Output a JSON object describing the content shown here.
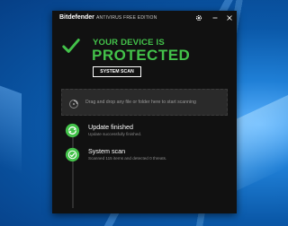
{
  "window": {
    "brand": "Bitdefender",
    "edition": "ANTIVIRUS FREE EDITION"
  },
  "titlebar_icons": [
    "gear-icon",
    "minimize-icon",
    "close-icon"
  ],
  "hero": {
    "line1": "YOUR DEVICE IS",
    "line2": "PROTECTED",
    "scan_button": "SYSTEM SCAN"
  },
  "dropzone": {
    "text": "Drag and drop any file or folder here to start scanning"
  },
  "events": [
    {
      "title": "Update finished",
      "desc": "Update successfully finished.",
      "icon": "update-icon"
    },
    {
      "title": "System scan",
      "desc": "Scanned 115 items and detected 0 threats.",
      "icon": "scan-check-icon"
    }
  ],
  "colors": {
    "accent_green": "#43c24a",
    "window_bg": "#111111"
  }
}
